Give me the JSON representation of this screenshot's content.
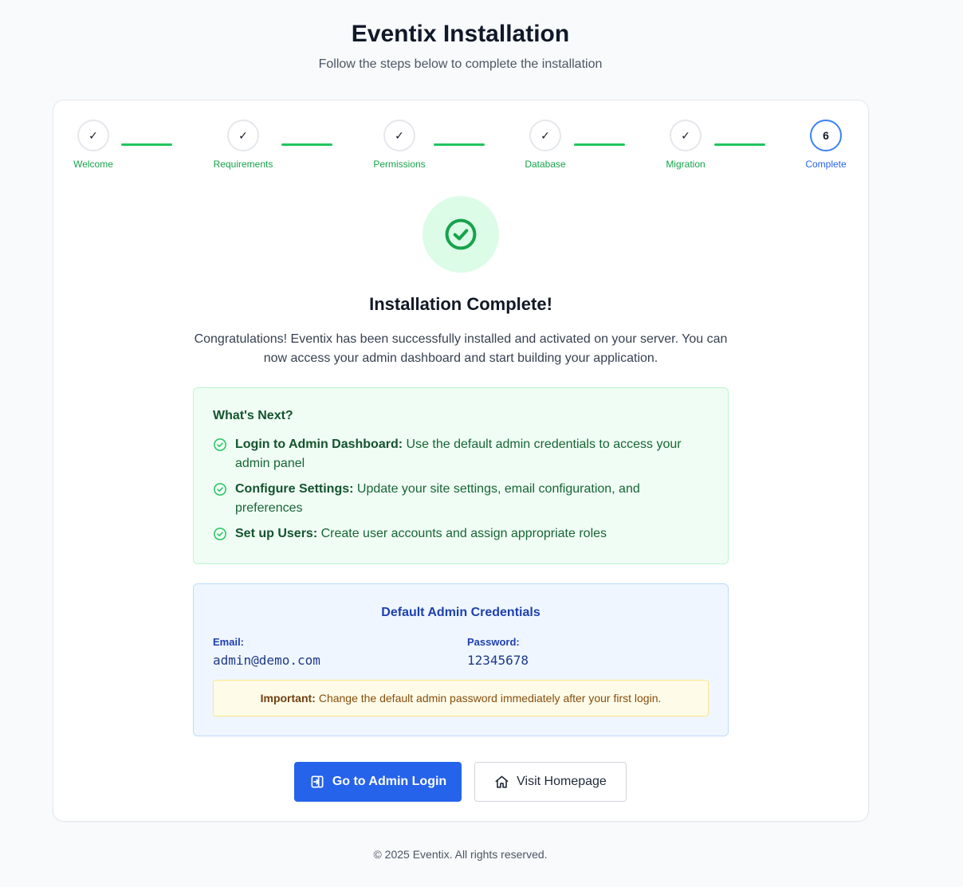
{
  "header": {
    "title": "Eventix Installation",
    "subtitle": "Follow the steps below to complete the installation"
  },
  "steps": [
    {
      "label": "Welcome",
      "state": "done",
      "marker": "✓"
    },
    {
      "label": "Requirements",
      "state": "done",
      "marker": "✓"
    },
    {
      "label": "Permissions",
      "state": "done",
      "marker": "✓"
    },
    {
      "label": "Database",
      "state": "done",
      "marker": "✓"
    },
    {
      "label": "Migration",
      "state": "done",
      "marker": "✓"
    },
    {
      "label": "Complete",
      "state": "current",
      "marker": "6"
    }
  ],
  "complete": {
    "icon": "check-circle-icon",
    "title": "Installation Complete!",
    "description": "Congratulations! Eventix has been successfully installed and activated on your server. You can now access your admin dashboard and start building your application."
  },
  "next": {
    "title": "What's Next?",
    "items": [
      {
        "bold": "Login to Admin Dashboard:",
        "text": " Use the default admin credentials to access your admin panel"
      },
      {
        "bold": "Configure Settings:",
        "text": " Update your site settings, email configuration, and preferences"
      },
      {
        "bold": "Set up Users:",
        "text": " Create user accounts and assign appropriate roles"
      }
    ]
  },
  "credentials": {
    "title": "Default Admin Credentials",
    "email_label": "Email:",
    "email_value": "admin@demo.com",
    "password_label": "Password:",
    "password_value": "12345678",
    "warning_bold": "Important:",
    "warning_text": "Change the default admin password immediately after your first login."
  },
  "actions": {
    "admin_login_label": "Go to Admin Login",
    "admin_login_icon": "login-icon",
    "homepage_label": "Visit Homepage",
    "homepage_icon": "home-icon"
  },
  "footer": {
    "text": "© 2025 Eventix. All rights reserved."
  },
  "colors": {
    "success": "#16a34a",
    "primary": "#2563eb",
    "current_step": "#3b82f6",
    "connector": "#22c55e"
  }
}
